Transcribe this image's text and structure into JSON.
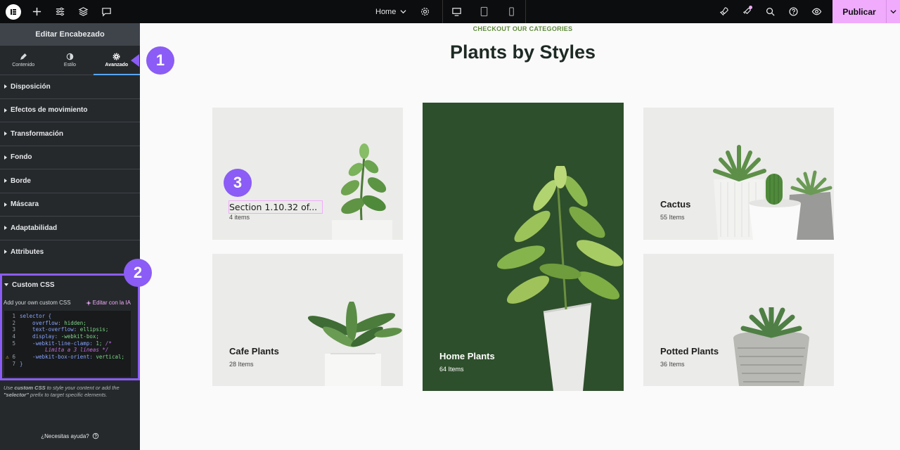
{
  "topbar": {
    "page_name": "Home",
    "publish_label": "Publicar"
  },
  "sidebar": {
    "panel_title": "Editar Encabezado",
    "tabs": [
      {
        "label": "Contenido"
      },
      {
        "label": "Estilo"
      },
      {
        "label": "Avanzado"
      }
    ],
    "sections": [
      {
        "label": "Disposición"
      },
      {
        "label": "Efectos de movimiento"
      },
      {
        "label": "Transformación"
      },
      {
        "label": "Fondo"
      },
      {
        "label": "Borde"
      },
      {
        "label": "Máscara"
      },
      {
        "label": "Adaptabilidad"
      },
      {
        "label": "Attributes"
      }
    ],
    "custom_css": {
      "title": "Custom CSS",
      "subtitle": "Add your own custom CSS",
      "ai_link": "Editar con la IA",
      "lines": [
        {
          "n": "1",
          "text": "selector {"
        },
        {
          "n": "2",
          "prop": "    overflow: ",
          "val": "hidden;"
        },
        {
          "n": "3",
          "prop": "    text-overflow: ",
          "val": "ellipsis;"
        },
        {
          "n": "4",
          "prop": "    display: ",
          "val": "-webkit-box;"
        },
        {
          "n": "5",
          "prop": "    -webkit-line-clamp: ",
          "val": "1;",
          "comment": " /*"
        },
        {
          "n": "",
          "comment": "        Limita a 3 líneas */"
        },
        {
          "n": "6",
          "prop": "    -webkit-box-orient: ",
          "val": "vertical;"
        },
        {
          "n": "7",
          "text": "}"
        }
      ],
      "help_prefix": "Use ",
      "help_bold1": "custom CSS",
      "help_mid": " to style your content or add the ",
      "help_bold2": "\"selector\"",
      "help_suffix": " prefix to target specific elements."
    },
    "need_help": "¿Necesitas ayuda?"
  },
  "badges": [
    "1",
    "2",
    "3"
  ],
  "canvas": {
    "eyebrow": "CHECKOUT OUR CATEGORIES",
    "title": "Plants by Styles",
    "cards": [
      {
        "title": "Section 1.10.32 of...",
        "count": "4 items"
      },
      {
        "title": "Cafe Plants",
        "count": "28 Items"
      },
      {
        "title": "Home Plants",
        "count": "64 Items"
      },
      {
        "title": "Cactus",
        "count": "55 Items"
      },
      {
        "title": "Potted Plants",
        "count": "36 Items"
      }
    ]
  },
  "colors": {
    "accent_purple": "#8b5cf6",
    "publish_pink": "#f0abfc",
    "dark_green": "#2e4f2b",
    "eyebrow_green": "#5f8a3a"
  }
}
